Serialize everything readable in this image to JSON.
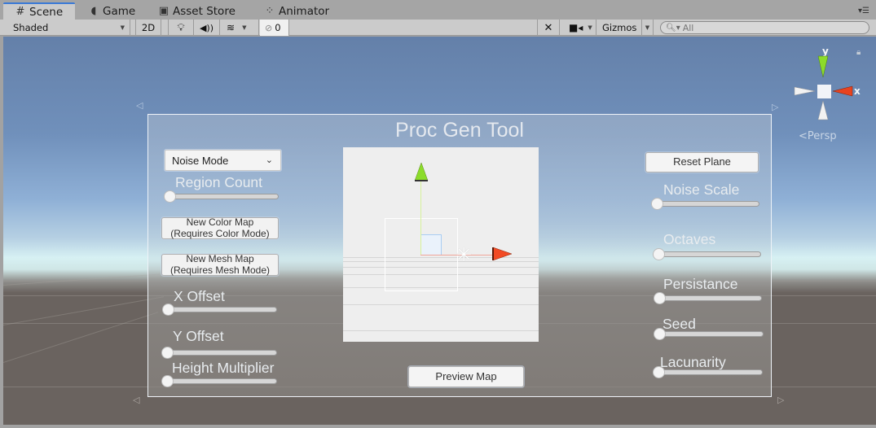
{
  "tabs": [
    {
      "label": "Scene",
      "icon": "grid-icon",
      "active": true
    },
    {
      "label": "Game",
      "icon": "pacman-icon",
      "active": false
    },
    {
      "label": "Asset Store",
      "icon": "store-bag-icon",
      "active": false
    },
    {
      "label": "Animator",
      "icon": "animator-icon",
      "active": false
    }
  ],
  "toolbar": {
    "shading_mode": "Shaded",
    "mode_2d": "2D",
    "hidden_count": "0",
    "gizmos_label": "Gizmos",
    "search_placeholder": "All"
  },
  "scene": {
    "projection_label": "Persp",
    "axis_labels": {
      "x": "x",
      "y": "y"
    },
    "colors": {
      "x_axis": "#e8431f",
      "y_axis": "#8cdc2a",
      "tab_accent": "#3a79d6"
    }
  },
  "panel": {
    "title": "Proc Gen Tool",
    "mode_dropdown": {
      "selected": "Noise Mode"
    },
    "left_sliders": [
      {
        "label": "Region Count",
        "value": 0
      },
      {
        "label": "X Offset",
        "value": 0
      },
      {
        "label": "Y Offset",
        "value": 0
      },
      {
        "label": "Height Multiplier",
        "value": 0
      }
    ],
    "buttons": {
      "new_color_map": [
        "New Color Map",
        "(Requires Color Mode)"
      ],
      "new_mesh_map": [
        "New Mesh Map",
        "(Requires Mesh Mode)"
      ],
      "reset_plane": "Reset Plane",
      "preview_map": "Preview Map"
    },
    "right_sliders": [
      {
        "label": "Noise Scale",
        "value": 0
      },
      {
        "label": "Octaves",
        "value": 0
      },
      {
        "label": "Persistance",
        "value": 0
      },
      {
        "label": "Seed",
        "value": 0
      },
      {
        "label": "Lacunarity",
        "value": 0
      }
    ]
  }
}
